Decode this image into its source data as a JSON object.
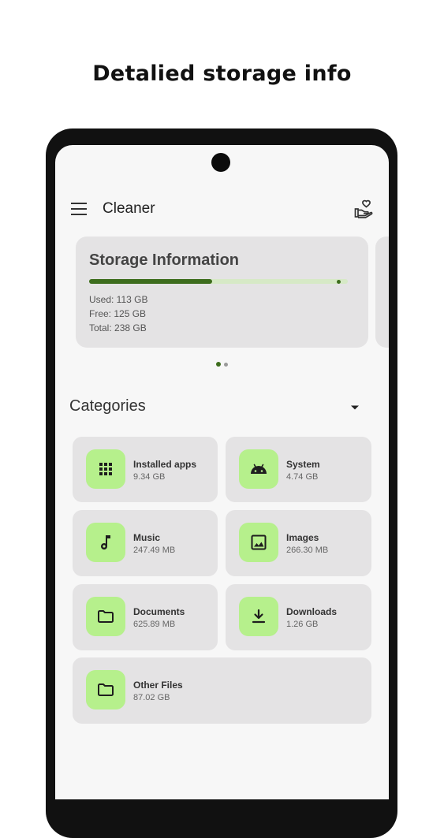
{
  "promo": {
    "headline": "Detalied storage info"
  },
  "appbar": {
    "title": "Cleaner"
  },
  "storage": {
    "title": "Storage Information",
    "used_label": "Used: 113 GB",
    "free_label": "Free: 125 GB",
    "total_label": "Total: 238 GB",
    "used_fraction": 0.475
  },
  "pager": {
    "pages": 2,
    "active": 0
  },
  "categories": {
    "title": "Categories",
    "items": [
      {
        "label": "Installed apps",
        "size": "9.34 GB",
        "icon": "apps-grid-icon"
      },
      {
        "label": "System",
        "size": "4.74 GB",
        "icon": "android-icon"
      },
      {
        "label": "Music",
        "size": "247.49 MB",
        "icon": "music-note-icon"
      },
      {
        "label": "Images",
        "size": "266.30 MB",
        "icon": "image-icon"
      },
      {
        "label": "Documents",
        "size": "625.89 MB",
        "icon": "folder-icon"
      },
      {
        "label": "Downloads",
        "size": "1.26 GB",
        "icon": "download-icon"
      },
      {
        "label": "Other Files",
        "size": "87.02 GB",
        "icon": "folder-icon"
      }
    ]
  },
  "colors": {
    "accent": "#3d6d1d",
    "icon_bg": "#b6f08c",
    "card_bg": "#e4e3e4",
    "progress_track": "#d6e9c6"
  }
}
